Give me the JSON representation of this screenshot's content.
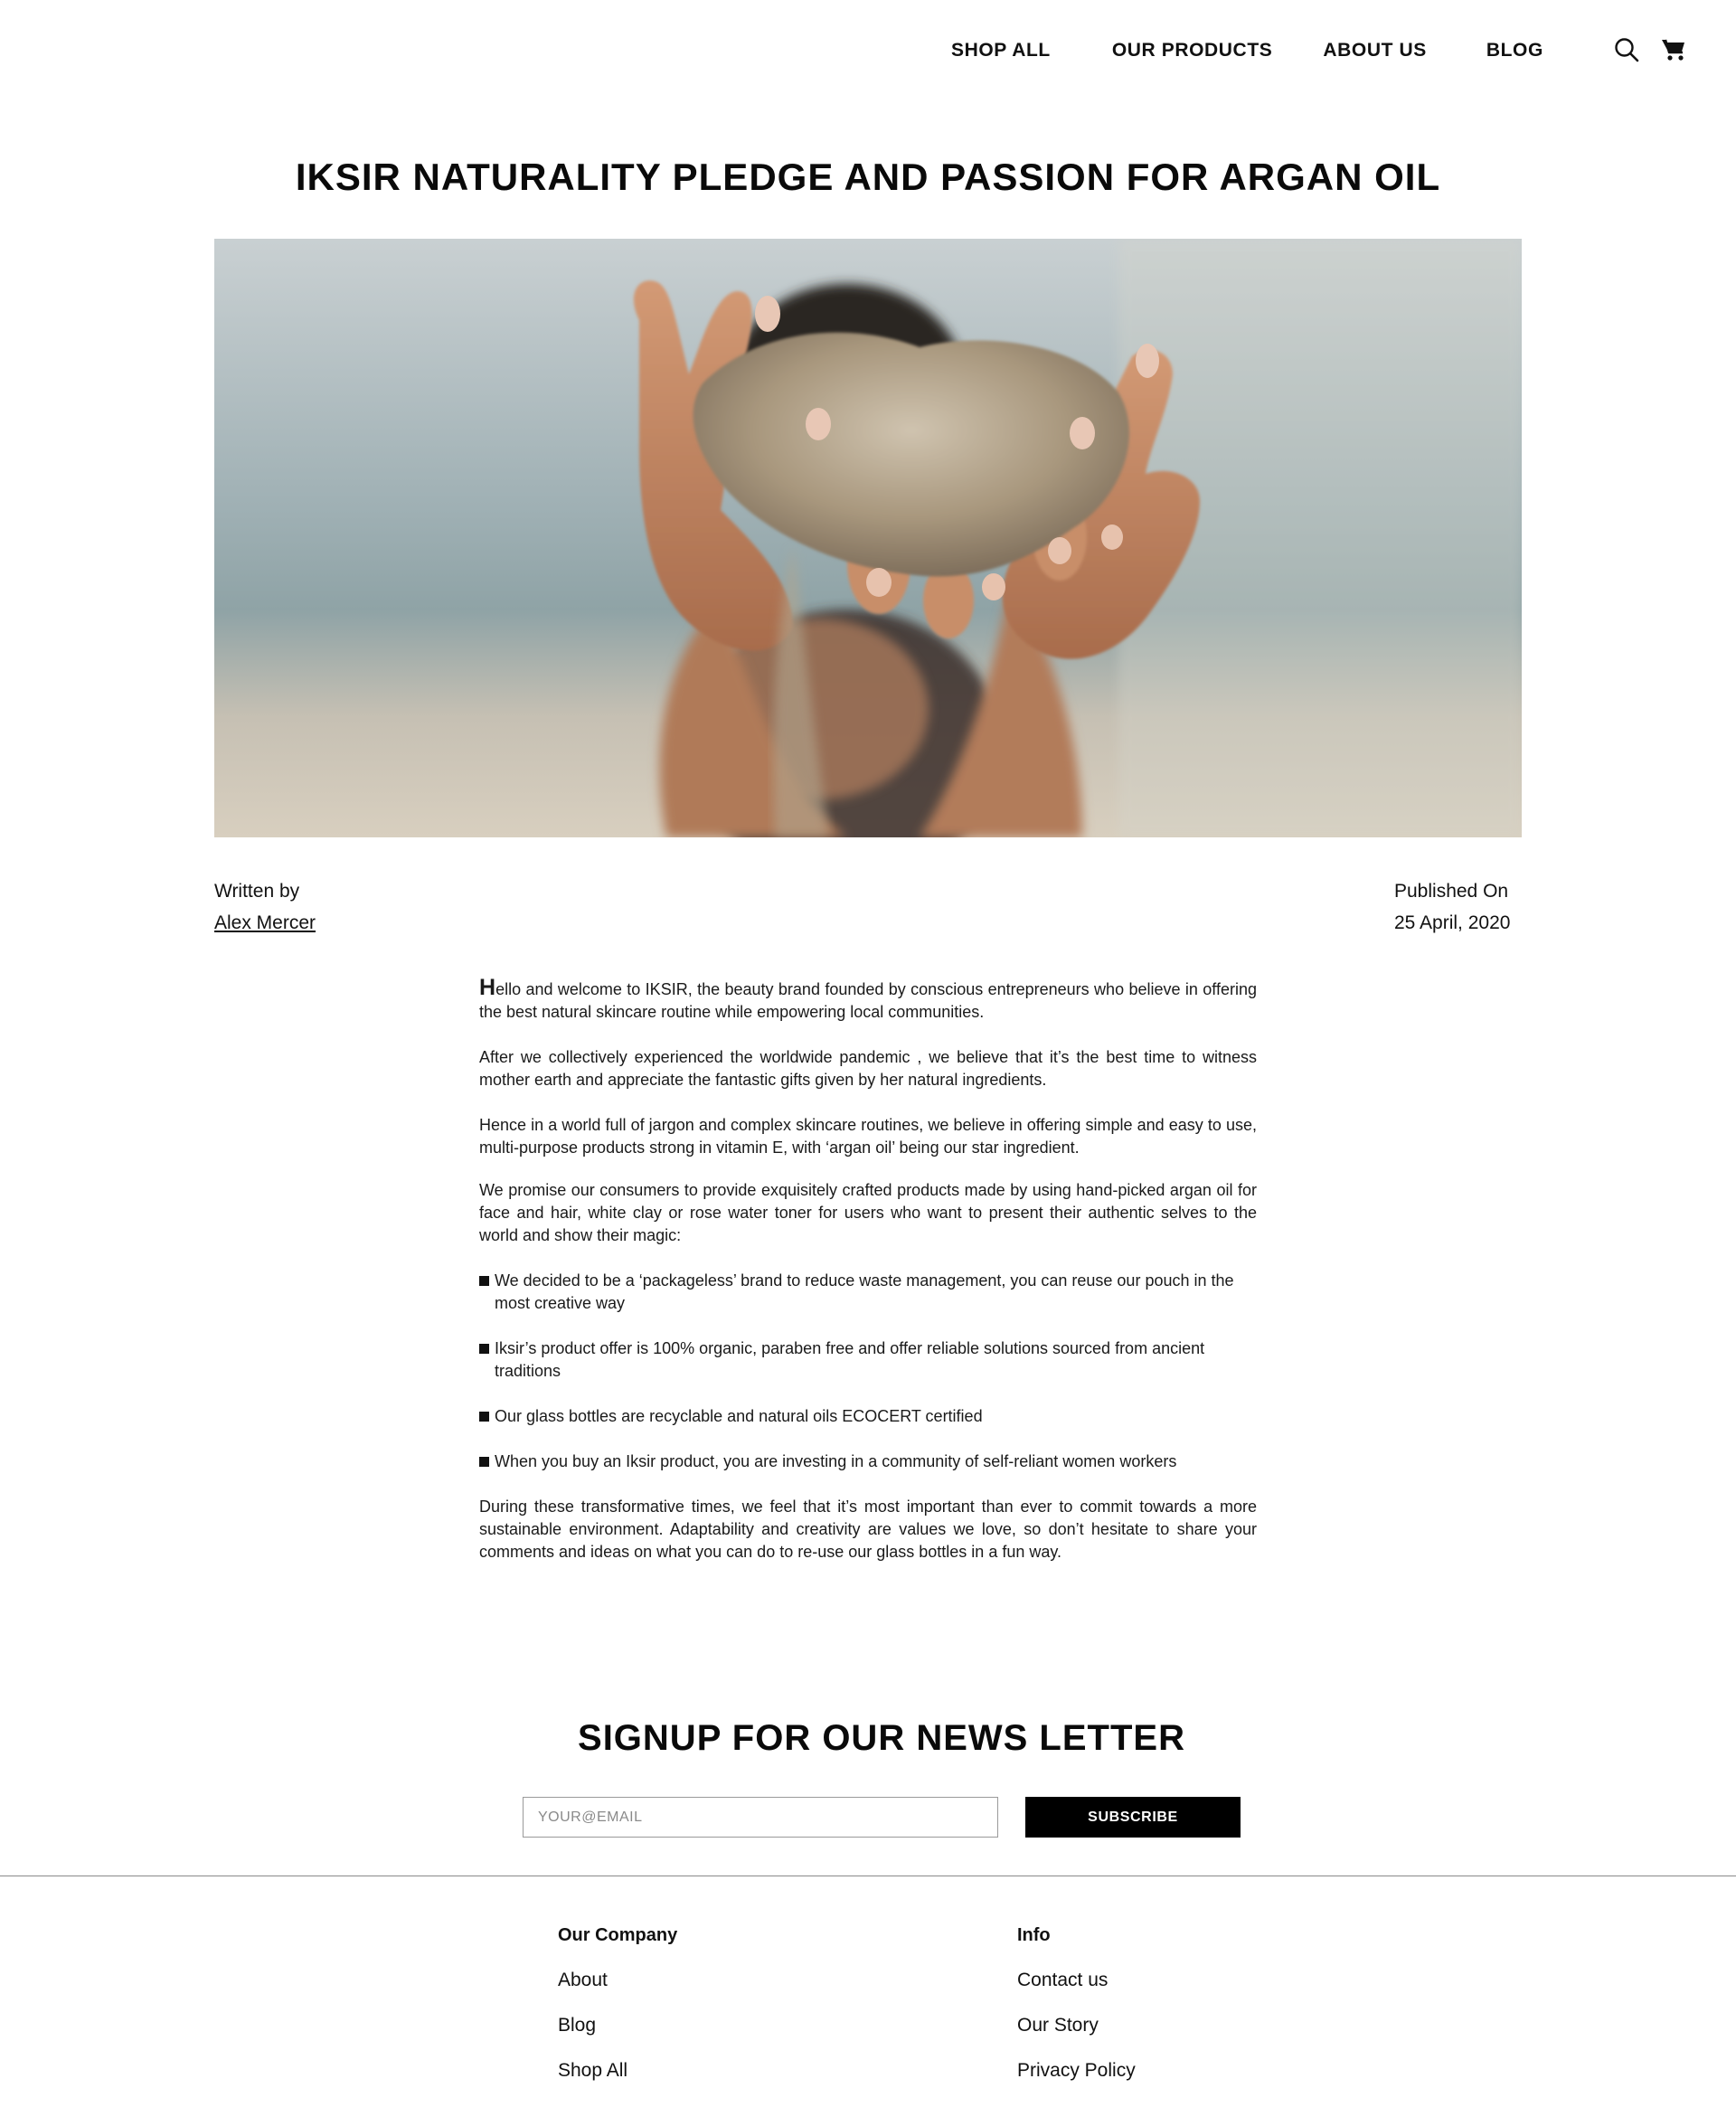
{
  "nav": {
    "links": [
      "SHOP ALL",
      "OUR PRODUCTS",
      "ABOUT US",
      "BLOG"
    ],
    "icons": [
      "search-icon",
      "cart-icon"
    ]
  },
  "article": {
    "title": "IKSIR NATURALITY PLEDGE AND PASSION FOR ARGAN OIL",
    "hero_image": "hands-holding-sand-photo",
    "written_by_label": "Written by",
    "author": "Alex Mercer",
    "published_label": "Published On",
    "published_date": "25 April, 2020",
    "intro_dropcap": "H",
    "intro_rest": "ello and welcome to IKSIR, the beauty brand founded by conscious entrepreneurs who believe in offering the best natural skincare routine while empowering local communities.",
    "paragraph_2": "After we collectively experienced the worldwide pandemic , we believe that it’s the best time to witness mother earth and appreciate the fantastic gifts given by her natural ingredients.",
    "paragraph_3": "Hence in a world full of jargon and complex skincare routines, we believe in offering simple and easy to use, multi-purpose products strong in vitamin E, with ‘argan oil’ being our star ingredient.",
    "paragraph_4": "We promise our consumers to provide exquisitely crafted products made by using hand-picked argan oil for face and hair, white clay or rose water toner for users who want to present their authentic selves to the world and show their magic:",
    "bullets": [
      "We decided to be a ‘packageless’ brand to reduce waste management, you can reuse our pouch in the most creative way",
      "Iksir’s product offer is 100% organic, paraben free and offer reliable solutions sourced from ancient traditions",
      "Our glass bottles are recyclable and natural oils ECOCERT certified",
      "When you buy an Iksir product, you are investing in a community of self-reliant women workers"
    ],
    "closing": "During these transformative times, we feel that it’s most important than ever to commit towards a more sustainable environment. Adaptability and creativity are values we love, so don’t hesitate to share your comments and ideas on what you can do to re-use our glass bottles in a fun way."
  },
  "newsletter": {
    "title": "SIGNUP FOR OUR NEWS LETTER",
    "email_placeholder": "YOUR@EMAIL",
    "email_value": "",
    "subscribe_label": "SUBSCRIBE"
  },
  "footer": {
    "company_heading": "Our Company",
    "company_links": [
      "About",
      "Blog",
      "Shop All"
    ],
    "info_heading": "Info",
    "info_links": [
      "Contact us",
      "Our Story",
      "Privacy Policy"
    ]
  }
}
